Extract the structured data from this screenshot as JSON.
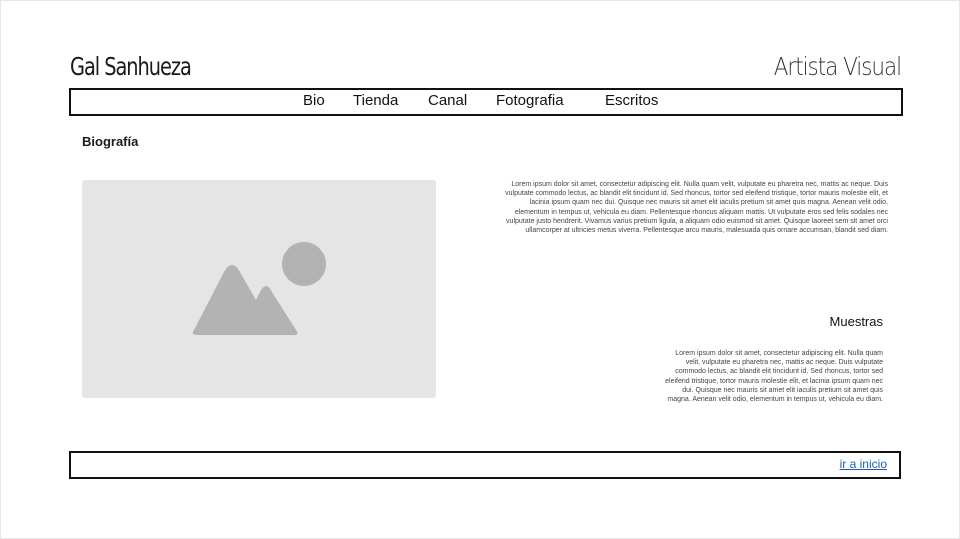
{
  "header": {
    "site_name": "Gal Sanhueza",
    "tagline": "Artista Visual"
  },
  "nav": {
    "items": [
      {
        "label": "Bio"
      },
      {
        "label": "Tienda"
      },
      {
        "label": "Canal"
      },
      {
        "label": "Fotografia"
      },
      {
        "label": "Escritos"
      }
    ]
  },
  "main": {
    "section_title": "Biografía",
    "image_icon": "image-placeholder-icon",
    "bio_text": "Lorem ipsum dolor sit amet, consectetur adipiscing elit. Nulla quam velit, vulputate eu pharetra nec, mattis ac neque. Duis vulputate commodo lectus, ac blandit elit tincidunt id. Sed rhoncus, tortor sed eleifend tristique, tortor mauris molestie elit, et lacinia ipsum quam nec dui. Quisque nec mauris sit amet elit iaculis pretium sit amet quis magna. Aenean velit odio, elementum in tempus ut, vehicula eu diam. Pellentesque rhoncus aliquam mattis. Ut vulputate eros sed felis sodales nec vulputate justo hendrerit. Vivamus varius pretium ligula, a aliquam odio euismod sit amet. Quisque laoreet sem sit amet orci ullamcorper at ultricies metus viverra. Pellentesque arcu mauris, malesuada quis ornare accumsan, blandit sed diam.",
    "samples_title": "Muestras",
    "samples_text": "Lorem ipsum dolor sit amet, consectetur adipiscing elit. Nulla quam velit, vulputate eu pharetra nec, mattis ac neque. Duis vulputate commodo lectus, ac blandit elit tincidunt id. Sed rhoncus, tortor sed eleifend tristique, tortor mauris molestie elit, et lacinia ipsum quam nec dui. Quisque nec mauris sit amet elit iaculis pretium sit amet quis magna. Aenean velit odio, elementum in tempus ut, vehicula eu diam."
  },
  "footer": {
    "back_link": "ir a inicio"
  },
  "colors": {
    "placeholder_bg": "#e5e5e5",
    "placeholder_shape": "#b3b3b3",
    "link": "#1a5fb4",
    "border": "#111111"
  }
}
